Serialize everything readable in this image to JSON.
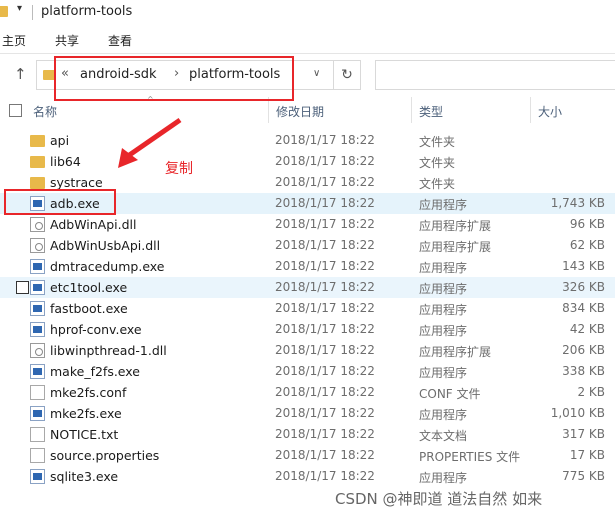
{
  "window": {
    "title": "platform-tools"
  },
  "ribbon": {
    "tabs": [
      "主页",
      "共享",
      "查看"
    ]
  },
  "address": {
    "overflow": "«",
    "crumbs": [
      "android-sdk",
      "platform-tools"
    ],
    "separator": "›"
  },
  "columns": {
    "name": "名称",
    "date": "修改日期",
    "type": "类型",
    "size": "大小"
  },
  "files": [
    {
      "name": "api",
      "date": "2018/1/17 18:22",
      "type": "文件夹",
      "size": "",
      "icon": "folder-icon"
    },
    {
      "name": "lib64",
      "date": "2018/1/17 18:22",
      "type": "文件夹",
      "size": "",
      "icon": "folder-icon"
    },
    {
      "name": "systrace",
      "date": "2018/1/17 18:22",
      "type": "文件夹",
      "size": "",
      "icon": "folder-icon"
    },
    {
      "name": "adb.exe",
      "date": "2018/1/17 18:22",
      "type": "应用程序",
      "size": "1,743 KB",
      "icon": "exe-icon"
    },
    {
      "name": "AdbWinApi.dll",
      "date": "2018/1/17 18:22",
      "type": "应用程序扩展",
      "size": "96 KB",
      "icon": "dll-icon"
    },
    {
      "name": "AdbWinUsbApi.dll",
      "date": "2018/1/17 18:22",
      "type": "应用程序扩展",
      "size": "62 KB",
      "icon": "dll-icon"
    },
    {
      "name": "dmtracedump.exe",
      "date": "2018/1/17 18:22",
      "type": "应用程序",
      "size": "143 KB",
      "icon": "exe-icon"
    },
    {
      "name": "etc1tool.exe",
      "date": "2018/1/17 18:22",
      "type": "应用程序",
      "size": "326 KB",
      "icon": "exe-icon"
    },
    {
      "name": "fastboot.exe",
      "date": "2018/1/17 18:22",
      "type": "应用程序",
      "size": "834 KB",
      "icon": "exe-icon"
    },
    {
      "name": "hprof-conv.exe",
      "date": "2018/1/17 18:22",
      "type": "应用程序",
      "size": "42 KB",
      "icon": "exe-icon"
    },
    {
      "name": "libwinpthread-1.dll",
      "date": "2018/1/17 18:22",
      "type": "应用程序扩展",
      "size": "206 KB",
      "icon": "dll-icon"
    },
    {
      "name": "make_f2fs.exe",
      "date": "2018/1/17 18:22",
      "type": "应用程序",
      "size": "338 KB",
      "icon": "exe-icon"
    },
    {
      "name": "mke2fs.conf",
      "date": "2018/1/17 18:22",
      "type": "CONF 文件",
      "size": "2 KB",
      "icon": "doc-icon"
    },
    {
      "name": "mke2fs.exe",
      "date": "2018/1/17 18:22",
      "type": "应用程序",
      "size": "1,010 KB",
      "icon": "exe-icon"
    },
    {
      "name": "NOTICE.txt",
      "date": "2018/1/17 18:22",
      "type": "文本文档",
      "size": "317 KB",
      "icon": "doc-icon"
    },
    {
      "name": "source.properties",
      "date": "2018/1/17 18:22",
      "type": "PROPERTIES 文件",
      "size": "17 KB",
      "icon": "doc-icon"
    },
    {
      "name": "sqlite3.exe",
      "date": "2018/1/17 18:22",
      "type": "应用程序",
      "size": "775 KB",
      "icon": "exe-icon"
    }
  ],
  "annotation": {
    "text": "复制",
    "color": "#e8262a"
  },
  "watermark": "CSDN @神即道 道法自然 如来"
}
